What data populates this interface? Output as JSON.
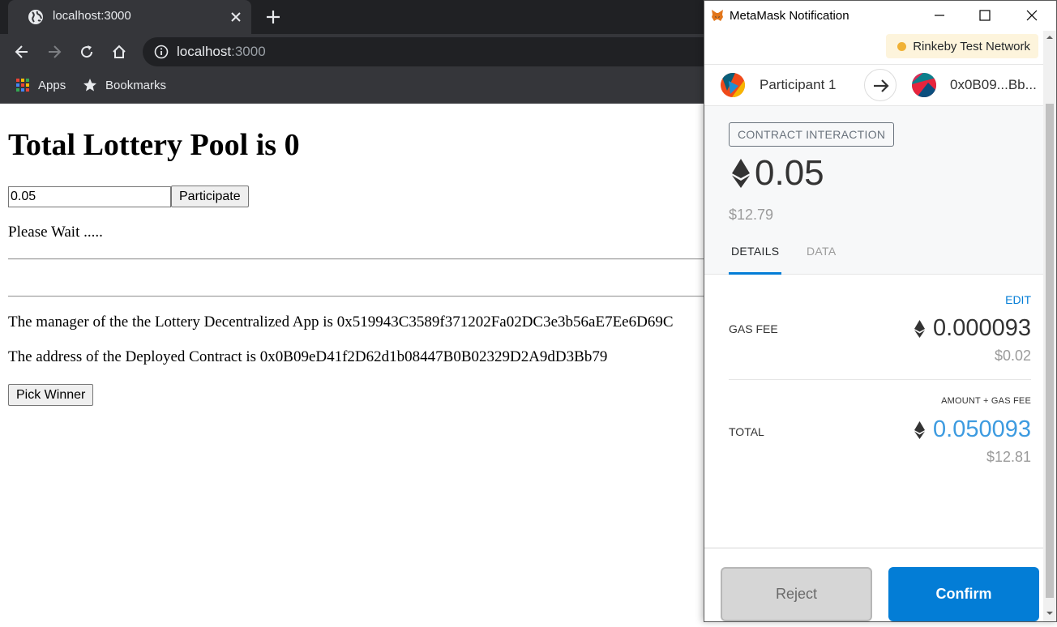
{
  "browser": {
    "tab_title": "localhost:3000",
    "url_host": "localhost",
    "url_port": ":3000",
    "bookmarks": [
      {
        "label": "Apps",
        "icon": "apps-grid-icon"
      },
      {
        "label": "Bookmarks",
        "icon": "star-icon"
      }
    ]
  },
  "page": {
    "heading": "Total Lottery Pool is 0",
    "amount_value": "0.05",
    "participate_label": "Participate",
    "status_text": "Please Wait .....",
    "manager_text": "The manager of the the Lottery Decentralized App is 0x519943C3589f371202Fa02DC3e3b56aE7Ee6D69C",
    "contract_text": "The address of the Deployed Contract is 0x0B09eD41f2D62d1b08447B0B02329D2A9dD3Bb79",
    "pick_winner_label": "Pick Winner"
  },
  "metamask": {
    "window_title": "MetaMask Notification",
    "network": "Rinkeby Test Network",
    "from_name": "Participant 1",
    "to_name": "0x0B09...Bb...",
    "badge": "CONTRACT INTERACTION",
    "amount": "0.05",
    "amount_fiat": "$12.79",
    "tabs": [
      "DETAILS",
      "DATA"
    ],
    "edit_label": "EDIT",
    "gas_fee_label": "GAS FEE",
    "gas_fee_value": "0.000093",
    "gas_fee_fiat": "$0.02",
    "total_sublabel": "AMOUNT + GAS FEE",
    "total_label": "TOTAL",
    "total_value": "0.050093",
    "total_fiat": "$12.81",
    "reject_label": "Reject",
    "confirm_label": "Confirm"
  },
  "colors": {
    "accent_blue": "#037dd6",
    "network_dot": "#f0b135",
    "chrome_dark": "#35363a"
  }
}
